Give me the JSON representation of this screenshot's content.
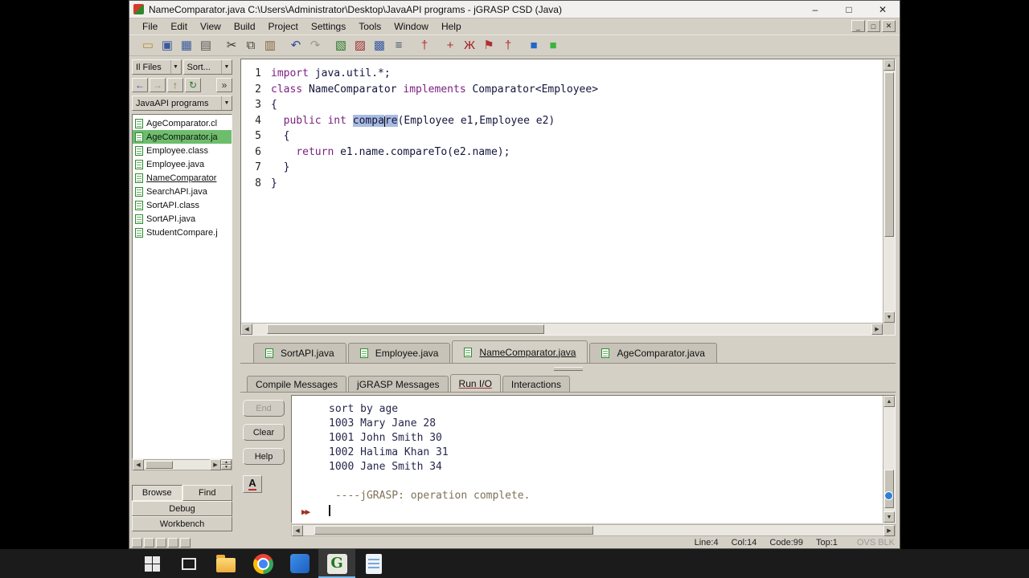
{
  "titlebar": {
    "title": "NameComparator.java C:\\Users\\Administrator\\Desktop\\JavaAPI programs - jGRASP CSD (Java)",
    "controls": {
      "minimize": "–",
      "maximize": "□",
      "close": "✕"
    }
  },
  "menubar": {
    "items": [
      "File",
      "Edit",
      "View",
      "Build",
      "Project",
      "Settings",
      "Tools",
      "Window",
      "Help"
    ],
    "mdi_controls": [
      {
        "name": "mdi-minimize-button",
        "glyph": "_"
      },
      {
        "name": "mdi-restore-button",
        "glyph": "□"
      },
      {
        "name": "mdi-close-button",
        "glyph": "✕"
      }
    ]
  },
  "toolbar": {
    "groups": [
      [
        {
          "name": "open-file-icon",
          "glyph": "▭",
          "color": "#b8902c"
        },
        {
          "name": "save-icon",
          "glyph": "▣",
          "color": "#3a5a9a"
        },
        {
          "name": "save-all-icon",
          "glyph": "▦",
          "color": "#3a5a9a"
        },
        {
          "name": "print-icon",
          "glyph": "▤",
          "color": "#5a5a5a"
        }
      ],
      [
        {
          "name": "cut-icon",
          "glyph": "✂",
          "color": "#333333"
        },
        {
          "name": "copy-icon",
          "glyph": "⧉",
          "color": "#444444"
        },
        {
          "name": "paste-icon",
          "glyph": "▥",
          "color": "#86643a"
        }
      ],
      [
        {
          "name": "undo-icon",
          "glyph": "↶",
          "color": "#2a4a9a"
        },
        {
          "name": "redo-icon",
          "glyph": "↷",
          "color": "#999999"
        }
      ],
      [
        {
          "name": "generate-csd-icon",
          "glyph": "▧",
          "color": "#2a7a2a"
        },
        {
          "name": "remove-csd-icon",
          "glyph": "▨",
          "color": "#a03030"
        },
        {
          "name": "view-book-icon",
          "glyph": "▩",
          "color": "#3a5aa0"
        },
        {
          "name": "number-lines-icon",
          "glyph": "≡",
          "color": "#445566"
        }
      ],
      [
        {
          "name": "freeze-pin-icon",
          "glyph": "†",
          "color": "#b03030"
        }
      ],
      [
        {
          "name": "compile-icon",
          "glyph": "+",
          "color": "#b03030"
        },
        {
          "name": "run-ant-icon",
          "glyph": "Ж",
          "color": "#a02020"
        },
        {
          "name": "debug-flag-icon",
          "glyph": "⚑",
          "color": "#b03030"
        },
        {
          "name": "breakpoint-pin-icon",
          "glyph": "†",
          "color": "#b03030"
        }
      ],
      [
        {
          "name": "interactions-square-icon",
          "glyph": "■",
          "color": "#1e68c8"
        },
        {
          "name": "workbench-square-icon",
          "glyph": "■",
          "color": "#3cb43c"
        }
      ]
    ]
  },
  "browse_panel": {
    "files_dropdown": "Il Files",
    "sort_dropdown": "Sort...",
    "project_dropdown": "JavaAPI programs",
    "nav_icons": [
      {
        "name": "back-icon",
        "glyph": "←",
        "color": "#2a4a9a"
      },
      {
        "name": "forward-icon",
        "glyph": "→",
        "color": "#9a968c"
      },
      {
        "name": "up-folder-icon",
        "glyph": "↑",
        "color": "#8a6a2a"
      },
      {
        "name": "refresh-icon",
        "glyph": "↻",
        "color": "#2a7a2a"
      },
      {
        "name": "more-icon",
        "glyph": "»",
        "color": "#333333"
      }
    ],
    "files": [
      {
        "label": "AgeComparator.cl",
        "state": "normal"
      },
      {
        "label": "AgeComparator.ja",
        "state": "selected"
      },
      {
        "label": "Employee.class",
        "state": "normal"
      },
      {
        "label": "Employee.java",
        "state": "normal"
      },
      {
        "label": "NameComparator",
        "state": "open"
      },
      {
        "label": "SearchAPI.java",
        "state": "normal"
      },
      {
        "label": "SortAPI.class",
        "state": "normal"
      },
      {
        "label": "SortAPI.java",
        "state": "normal"
      },
      {
        "label": "StudentCompare.j",
        "state": "normal"
      }
    ],
    "mode_buttons": [
      "Browse",
      "Find",
      "Debug",
      "Workbench"
    ]
  },
  "editor": {
    "lines": [
      {
        "num": "1",
        "segments": [
          {
            "type": "kw",
            "text": "import"
          },
          {
            "type": "plain",
            "text": " java.util.*;"
          }
        ]
      },
      {
        "num": "2",
        "segments": [
          {
            "type": "kw",
            "text": "class"
          },
          {
            "type": "plain",
            "text": " NameComparator "
          },
          {
            "type": "kw",
            "text": "implements"
          },
          {
            "type": "plain",
            "text": " Comparator<Employee>"
          }
        ]
      },
      {
        "num": "3",
        "segments": [
          {
            "type": "plain",
            "text": "{"
          }
        ]
      },
      {
        "num": "4",
        "segments": [
          {
            "type": "plain",
            "text": "  "
          },
          {
            "type": "kw",
            "text": "public"
          },
          {
            "type": "plain",
            "text": " "
          },
          {
            "type": "kw",
            "text": "int"
          },
          {
            "type": "plain",
            "text": " "
          },
          {
            "type": "sel",
            "text": "compa"
          },
          {
            "type": "caret",
            "text": ""
          },
          {
            "type": "sel",
            "text": "re"
          },
          {
            "type": "plain",
            "text": "(Employee e1,Employee e2)"
          }
        ]
      },
      {
        "num": "5",
        "segments": [
          {
            "type": "plain",
            "text": "  {"
          }
        ]
      },
      {
        "num": "6",
        "segments": [
          {
            "type": "plain",
            "text": "    "
          },
          {
            "type": "kw",
            "text": "return"
          },
          {
            "type": "plain",
            "text": " e1.name.compareTo(e2.name);"
          }
        ]
      },
      {
        "num": "7",
        "segments": [
          {
            "type": "plain",
            "text": "  }"
          }
        ]
      },
      {
        "num": "8",
        "segments": [
          {
            "type": "plain",
            "text": "}"
          }
        ]
      }
    ]
  },
  "file_tabs": [
    {
      "label": "SortAPI.java",
      "active": false
    },
    {
      "label": "Employee.java",
      "active": false
    },
    {
      "label": "NameComparator.java",
      "active": true
    },
    {
      "label": "AgeComparator.java",
      "active": false
    }
  ],
  "message_tabs": [
    {
      "label": "Compile Messages",
      "active": false
    },
    {
      "label": "jGRASP Messages",
      "active": false
    },
    {
      "label": "Run I/O",
      "active": true
    },
    {
      "label": "Interactions",
      "active": false
    }
  ],
  "run_io": {
    "buttons": [
      {
        "label": "End",
        "disabled": true
      },
      {
        "label": "Clear",
        "disabled": false
      },
      {
        "label": "Help",
        "disabled": false
      }
    ],
    "font_button": "A",
    "output_lines": [
      "sort by age",
      "1003 Mary Jane 28",
      "1001 John Smith 30",
      "1002 Halima Khan 31",
      "1000 Jane Smith 34"
    ],
    "system_line": " ----jGRASP: operation complete.",
    "prompt_marker": "▶▶"
  },
  "status_bar": {
    "line": "Line:4",
    "col": "Col:14",
    "code": "Code:99",
    "top": "Top:1",
    "mode": "OVS BLK",
    "toggles": [
      "statusbar-toggle-1",
      "statusbar-toggle-2",
      "statusbar-toggle-3",
      "statusbar-toggle-4",
      "statusbar-toggle-5"
    ]
  },
  "taskbar": {
    "icons": [
      {
        "name": "start-icon",
        "type": "start",
        "active": false
      },
      {
        "name": "task-view-icon",
        "type": "taskview",
        "active": false
      },
      {
        "name": "file-explorer-icon",
        "type": "folder",
        "active": false
      },
      {
        "name": "chrome-icon",
        "type": "chrome",
        "active": false
      },
      {
        "name": "blue-app-icon",
        "type": "blueapp",
        "active": false
      },
      {
        "name": "jgrasp-icon",
        "type": "jgrasp",
        "glyph": "G",
        "active": true
      },
      {
        "name": "text-editor-icon",
        "type": "notepad",
        "active": false
      }
    ]
  },
  "colors": {
    "keyword": "#7b2082",
    "plain_code": "#14143c",
    "selection": "#a9bcdf",
    "selected_file_bg": "#6dbd6d",
    "io_text": "#26264c",
    "io_system": "#7d7258",
    "app_bg": "#d4d0c6",
    "interactions_square": "#1e68c8",
    "workbench_square": "#3cb43c"
  }
}
